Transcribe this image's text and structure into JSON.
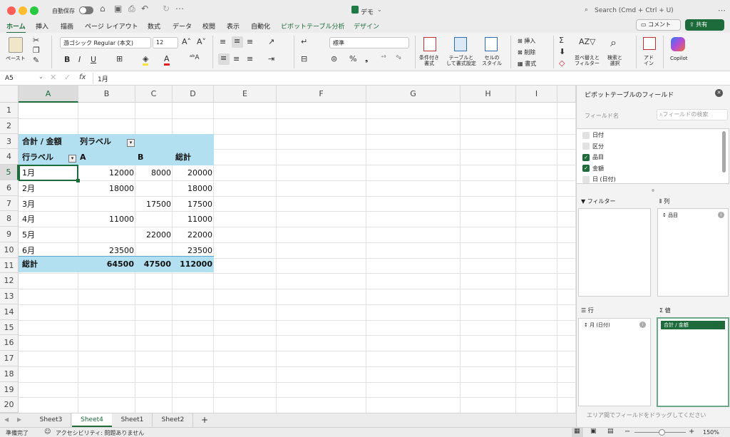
{
  "titlebar": {
    "autosave": "自動保存",
    "doc_title": "デモ",
    "search": "Search (Cmd + Ctrl + U)"
  },
  "menu": {
    "tabs": [
      "ホーム",
      "挿入",
      "描画",
      "ページ レイアウト",
      "数式",
      "データ",
      "校閲",
      "表示",
      "自動化",
      "ピボットテーブル分析",
      "デザイン"
    ],
    "comments": "コメント",
    "share": "共有"
  },
  "ribbon": {
    "paste": "ペースト",
    "font_name": "游ゴシック Regular (本文)",
    "font_size": "12",
    "number_format": "標準",
    "cond_format": "条件付き\n書式",
    "table_format": "テーブルと\nして書式設定",
    "cell_style": "セルの\nスタイル",
    "insert": "挿入",
    "delete": "削除",
    "format": "書式",
    "sort_filter": "並べ替えと\nフィルター",
    "find_select": "検索と\n選択",
    "addin": "アド\nイン",
    "copilot": "Copilot",
    "bold": "B",
    "italic": "I",
    "underline": "U"
  },
  "formula_bar": {
    "cell_ref": "A5",
    "fx": "fx",
    "value": "1月"
  },
  "columns": [
    "A",
    "B",
    "C",
    "D",
    "E",
    "F",
    "G",
    "H",
    "I"
  ],
  "rows": [
    "1",
    "2",
    "3",
    "4",
    "5",
    "6",
    "7",
    "8",
    "9",
    "10",
    "11",
    "12",
    "13",
    "14",
    "15",
    "16",
    "17",
    "18",
    "19",
    "20"
  ],
  "pivot": {
    "header_sum": "合計 / 金額",
    "header_col": "列ラベル",
    "row_label": "行ラベル",
    "col_a": "A",
    "col_b": "B",
    "col_total": "総計",
    "data": [
      {
        "label": "1月",
        "a": "12000",
        "b": "8000",
        "t": "20000"
      },
      {
        "label": "2月",
        "a": "18000",
        "b": "",
        "t": "18000"
      },
      {
        "label": "3月",
        "a": "",
        "b": "17500",
        "t": "17500"
      },
      {
        "label": "4月",
        "a": "11000",
        "b": "",
        "t": "11000"
      },
      {
        "label": "5月",
        "a": "",
        "b": "22000",
        "t": "22000"
      },
      {
        "label": "6月",
        "a": "23500",
        "b": "",
        "t": "23500"
      }
    ],
    "total": {
      "label": "総計",
      "a": "64500",
      "b": "47500",
      "t": "112000"
    }
  },
  "sheets": [
    "Sheet3",
    "Sheet4",
    "Sheet1",
    "Sheet2"
  ],
  "add_sheet": "+",
  "status": {
    "ready": "準備完了",
    "accessibility": "アクセシビリティ: 問題ありません",
    "zoom": "150%"
  },
  "pane": {
    "title": "ピボットテーブルのフィールド",
    "field_name": "フィールド名",
    "search_placeholder": "フィールドの検索",
    "fields": [
      {
        "label": "日付",
        "checked": false
      },
      {
        "label": "区分",
        "checked": false
      },
      {
        "label": "品目",
        "checked": true
      },
      {
        "label": "金額",
        "checked": true
      },
      {
        "label": "日 (日付)",
        "checked": false
      }
    ],
    "filter_label": "フィルター",
    "columns_label": "列",
    "rows_label": "行",
    "values_label": "値",
    "col_item": "品目",
    "row_item": "月 (日付)",
    "value_item": "合計 / 金額",
    "hint": "エリア間でフィールドをドラッグしてください"
  },
  "colors": {
    "accent": "#1d6b3a",
    "pivot_header": "#b3e0f0"
  }
}
